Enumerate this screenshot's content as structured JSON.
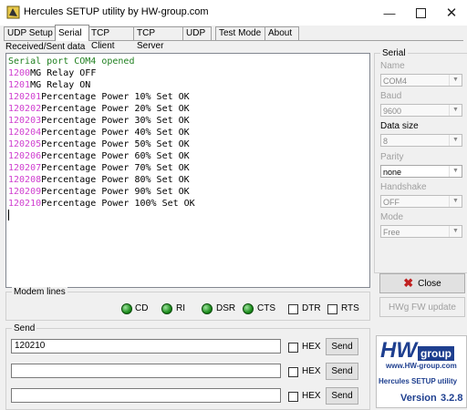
{
  "window": {
    "title": "Hercules SETUP utility by HW-group.com"
  },
  "tabs": [
    "UDP Setup",
    "Serial",
    "TCP Client",
    "TCP Server",
    "UDP",
    "Test Mode",
    "About"
  ],
  "received": {
    "label": "Received/Sent data",
    "lines": [
      {
        "prefix": "",
        "text": "Serial port COM4 opened",
        "color": "#208020"
      },
      {
        "prefix": "1200",
        "text": "MG Relay OFF"
      },
      {
        "prefix": "1201",
        "text": "MG Relay ON"
      },
      {
        "prefix": "120201",
        "text": "Percentage Power 10% Set OK"
      },
      {
        "prefix": "120202",
        "text": "Percentage Power 20% Set OK"
      },
      {
        "prefix": "120203",
        "text": "Percentage Power 30% Set OK"
      },
      {
        "prefix": "120204",
        "text": "Percentage Power 40% Set OK"
      },
      {
        "prefix": "120205",
        "text": "Percentage Power 50% Set OK"
      },
      {
        "prefix": "120206",
        "text": "Percentage Power 60% Set OK"
      },
      {
        "prefix": "120207",
        "text": "Percentage Power 70% Set OK"
      },
      {
        "prefix": "120208",
        "text": "Percentage Power 80% Set OK"
      },
      {
        "prefix": "120209",
        "text": "Percentage Power 90% Set OK"
      },
      {
        "prefix": "120210",
        "text": "Percentage Power 100% Set OK"
      }
    ]
  },
  "serial": {
    "group_label": "Serial",
    "name_label": "Name",
    "name_value": "COM4",
    "baud_label": "Baud",
    "baud_value": "9600",
    "datasize_label": "Data size",
    "datasize_value": "8",
    "parity_label": "Parity",
    "parity_value": "none",
    "handshake_label": "Handshake",
    "handshake_value": "OFF",
    "mode_label": "Mode",
    "mode_value": "Free",
    "close_label": "Close",
    "fw_update_label": "HWg FW update"
  },
  "modem": {
    "label": "Modem lines",
    "cd": "CD",
    "ri": "RI",
    "dsr": "DSR",
    "cts": "CTS",
    "dtr": "DTR",
    "rts": "RTS"
  },
  "send": {
    "label": "Send",
    "rows": [
      {
        "value": "120210",
        "hex_label": "HEX",
        "send_label": "Send"
      },
      {
        "value": "",
        "hex_label": "HEX",
        "send_label": "Send"
      },
      {
        "value": "",
        "hex_label": "HEX",
        "send_label": "Send"
      }
    ]
  },
  "logo": {
    "brand_hw": "HW",
    "brand_group": "group",
    "url": "www.HW-group.com",
    "product": "Hercules SETUP utility",
    "version_label": "Version",
    "version": "3.2.8"
  },
  "colors": {
    "prefix": "#d040d0",
    "opened": "#208020",
    "logo_blue": "#1e3f8f",
    "close_x": "#c02020"
  }
}
